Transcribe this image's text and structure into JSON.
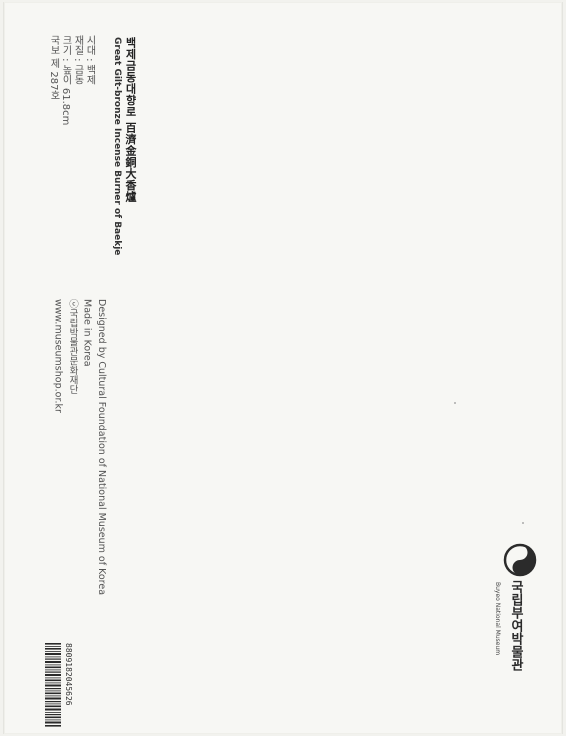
{
  "product": {
    "title_ko": "백제금동대향로  百濟金銅大香爐",
    "title_en": "Great Gilt-bronze Incense Burner of Baekje"
  },
  "specs": [
    "시대 : 백제",
    "재질 : 금동",
    "크기 : 높이 61.8cm",
    "국보 제 287호"
  ],
  "credits": [
    "Designed by Cultural Foundation of National Museum of Korea",
    "Made in Korea",
    "ⓒ국립박물관문화재단",
    "www.museumshop.or.kr"
  ],
  "barcode": {
    "number": "8809182045626"
  },
  "museum": {
    "name_ko": "국립부여박물관",
    "name_en": "Buyeo National Museum",
    "logo_icon": "taegeuk-emblem-icon",
    "colors": {
      "emblem": "#2b2b2b"
    }
  }
}
